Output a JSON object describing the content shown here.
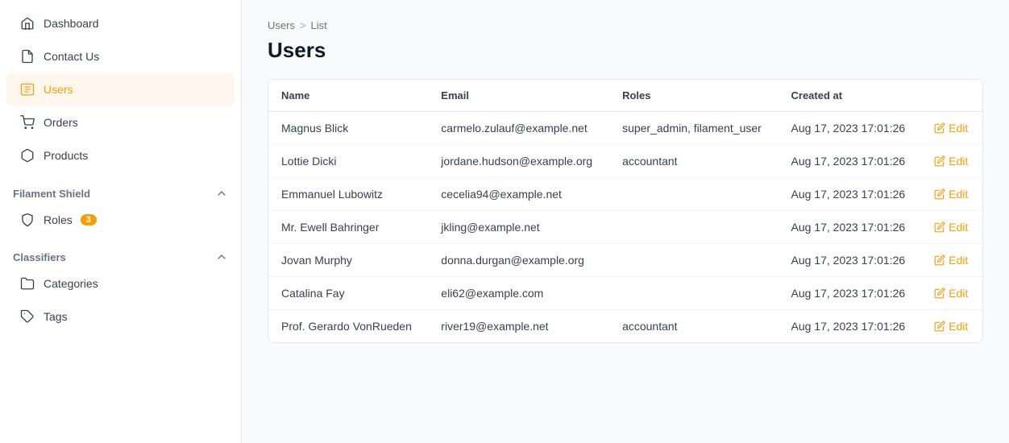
{
  "sidebar": {
    "items": [
      {
        "id": "dashboard",
        "label": "Dashboard",
        "icon": "home-icon",
        "active": false
      },
      {
        "id": "contact-us",
        "label": "Contact Us",
        "icon": "file-icon",
        "active": false
      },
      {
        "id": "users",
        "label": "Users",
        "icon": "users-icon",
        "active": true
      },
      {
        "id": "orders",
        "label": "Orders",
        "icon": "cart-icon",
        "active": false
      },
      {
        "id": "products",
        "label": "Products",
        "icon": "box-icon",
        "active": false
      }
    ],
    "sections": [
      {
        "id": "filament-shield",
        "label": "Filament Shield",
        "collapsed": false,
        "items": [
          {
            "id": "roles",
            "label": "Roles",
            "icon": "shield-icon",
            "badge": "3"
          }
        ]
      },
      {
        "id": "classifiers",
        "label": "Classifiers",
        "collapsed": false,
        "items": [
          {
            "id": "categories",
            "label": "Categories",
            "icon": "folder-icon"
          },
          {
            "id": "tags",
            "label": "Tags",
            "icon": "tag-icon"
          }
        ]
      }
    ]
  },
  "breadcrumb": {
    "parent": "Users",
    "separator": ">",
    "current": "List"
  },
  "page": {
    "title": "Users"
  },
  "table": {
    "columns": [
      "Name",
      "Email",
      "Roles",
      "Created at",
      ""
    ],
    "rows": [
      {
        "name": "Magnus Blick",
        "email": "carmelo.zulauf@example.net",
        "roles": "super_admin, filament_user",
        "created_at": "Aug 17, 2023 17:01:26",
        "action": "Edit"
      },
      {
        "name": "Lottie Dicki",
        "email": "jordane.hudson@example.org",
        "roles": "accountant",
        "created_at": "Aug 17, 2023 17:01:26",
        "action": "Edit"
      },
      {
        "name": "Emmanuel Lubowitz",
        "email": "cecelia94@example.net",
        "roles": "",
        "created_at": "Aug 17, 2023 17:01:26",
        "action": "Edit"
      },
      {
        "name": "Mr. Ewell Bahringer",
        "email": "jkling@example.net",
        "roles": "",
        "created_at": "Aug 17, 2023 17:01:26",
        "action": "Edit"
      },
      {
        "name": "Jovan Murphy",
        "email": "donna.durgan@example.org",
        "roles": "",
        "created_at": "Aug 17, 2023 17:01:26",
        "action": "Edit"
      },
      {
        "name": "Catalina Fay",
        "email": "eli62@example.com",
        "roles": "",
        "created_at": "Aug 17, 2023 17:01:26",
        "action": "Edit"
      },
      {
        "name": "Prof. Gerardo VonRueden",
        "email": "river19@example.net",
        "roles": "accountant",
        "created_at": "Aug 17, 2023 17:01:26",
        "action": "Edit"
      }
    ]
  },
  "colors": {
    "accent": "#f59e0b"
  }
}
